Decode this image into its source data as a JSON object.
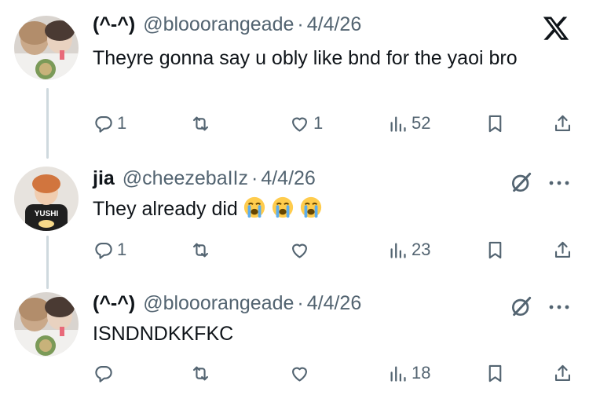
{
  "tweets": [
    {
      "name": "(^-^)",
      "handle": "@blooorangeade",
      "date": "4/4/26",
      "text": "Theyre gonna say u obly like bnd for the yaoi bro",
      "replies": "1",
      "retweets": "",
      "likes": "1",
      "views": "52",
      "top_icon": "x-logo-icon"
    },
    {
      "name": "jia",
      "handle": "@cheezebaIIz",
      "date": "4/4/26",
      "text": "They already did",
      "emojis": [
        "loudly-crying-face-emoji",
        "loudly-crying-face-emoji",
        "loudly-crying-face-emoji"
      ],
      "avatar_label": "YUSHI",
      "replies": "1",
      "retweets": "",
      "likes": "",
      "views": "23",
      "top_icon": "grok-icon"
    },
    {
      "name": "(^-^)",
      "handle": "@blooorangeade",
      "date": "4/4/26",
      "text": "ISNDNDKKFKC",
      "replies": "",
      "retweets": "",
      "likes": "",
      "views": "18",
      "top_icon": "grok-icon"
    }
  ],
  "separator": "·",
  "colors": {
    "text": "#0f1419",
    "secondary": "#536471",
    "thread_line": "#cfd9de",
    "emoji": "#ffcc4d"
  }
}
